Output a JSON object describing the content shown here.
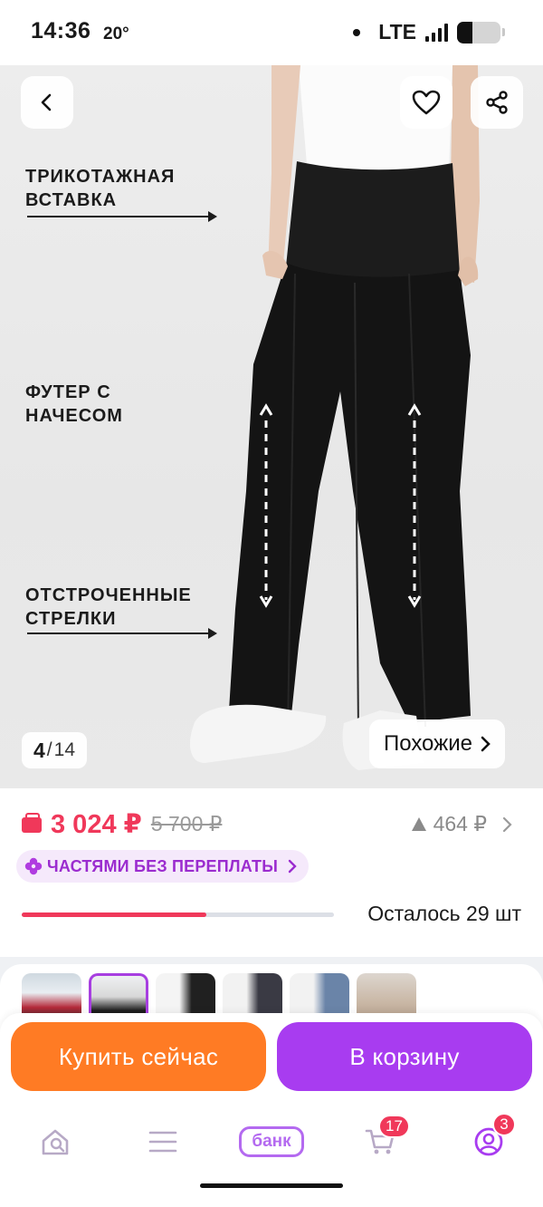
{
  "status_bar": {
    "time": "14:36",
    "temperature": "20°",
    "network": "LTE",
    "signal_icon": "signal-bars-icon",
    "battery_icon": "battery-icon",
    "battery_level": 0.36
  },
  "product_image": {
    "annotations": [
      "ТРИКОТАЖНАЯ ВСТАВКА",
      "ФУТЕР С НАЧЕСОМ",
      "ОТСТРОЧЕННЫЕ СТРЕЛКИ"
    ],
    "counter_current": "4",
    "counter_separator": "/",
    "counter_total": "14",
    "similar_label": "Похожие",
    "icons": {
      "back": "chevron-left-icon",
      "like": "heart-icon",
      "share": "share-icon",
      "similar": "chevron-right-icon"
    }
  },
  "pricing": {
    "price": "3 024 ₽",
    "old_price": "5 700 ₽",
    "bonus": "464 ₽",
    "installment_label": "ЧАСТЯМИ БЕЗ ПЕРЕПЛАТЫ",
    "colors": {
      "accent": "#f0385a",
      "installment": "#9b2ccf"
    }
  },
  "stock": {
    "label": "Осталось 29 шт",
    "level": 0.59
  },
  "gallery": {
    "selected_index": 1,
    "count": 6
  },
  "actions": {
    "buy_now": "Купить сейчас",
    "add_to_cart": "В корзину",
    "colors": {
      "buy": "#ff7b24",
      "cart": "#a83cf0"
    }
  },
  "bottom_nav": {
    "items": [
      {
        "name": "home",
        "icon": "home-search-icon"
      },
      {
        "name": "catalog",
        "icon": "menu-icon"
      },
      {
        "name": "bank",
        "label": "банк"
      },
      {
        "name": "cart",
        "icon": "cart-icon",
        "badge": "17"
      },
      {
        "name": "profile",
        "icon": "profile-icon",
        "badge": "3"
      }
    ]
  }
}
